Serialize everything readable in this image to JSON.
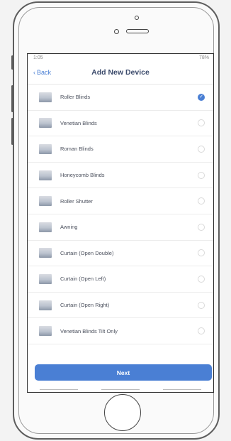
{
  "status": {
    "time": "1:05",
    "right": "78%"
  },
  "nav": {
    "back_label": "Back",
    "title": "Add New Device"
  },
  "devices": [
    {
      "label": "Roller Blinds",
      "selected": true
    },
    {
      "label": "Venetian Blinds",
      "selected": false
    },
    {
      "label": "Roman Blinds",
      "selected": false
    },
    {
      "label": "Honeycomb Blinds",
      "selected": false
    },
    {
      "label": "Roller Shutter",
      "selected": false
    },
    {
      "label": "Awning",
      "selected": false
    },
    {
      "label": "Curtain (Open Double)",
      "selected": false
    },
    {
      "label": "Curtain (Open Left)",
      "selected": false
    },
    {
      "label": "Curtain (Open Right)",
      "selected": false
    },
    {
      "label": "Venetian Blinds Tilt Only",
      "selected": false
    }
  ],
  "next_label": "Next",
  "colors": {
    "accent": "#4a7fd4",
    "title": "#3c4b6c"
  }
}
